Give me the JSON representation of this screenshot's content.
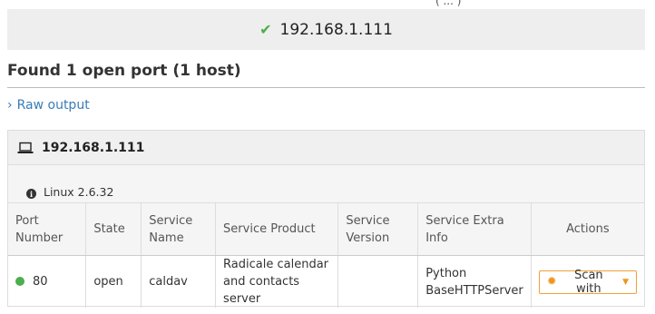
{
  "top_clip": "( ... )",
  "banner": {
    "icon": "check-icon",
    "host": "192.168.1.111",
    "accent": "#4cae4c"
  },
  "summary": {
    "title": "Found 1 open port (1 host)"
  },
  "raw_output": {
    "label": "Raw output",
    "icon": "chevron-right-icon",
    "color": "#3a7cb7"
  },
  "host_panel": {
    "icon": "laptop-icon",
    "host": "192.168.1.111",
    "os": "Linux 2.6.32",
    "os_icon": "info-icon"
  },
  "table": {
    "headers": {
      "port_number": [
        "Port",
        "Number"
      ],
      "state": "State",
      "service_name": [
        "Service",
        "Name"
      ],
      "service_product": "Service Product",
      "service_version": [
        "Service",
        "Version"
      ],
      "service_extra": [
        "Service Extra",
        "Info"
      ],
      "actions": "Actions"
    },
    "rows": [
      {
        "status_color": "#4cae4c",
        "port": "80",
        "state": "open",
        "service": "caldav",
        "product": [
          "Radicale calendar",
          "and contacts server"
        ],
        "version": "",
        "extra": [
          "Python",
          "BaseHTTPServer"
        ],
        "action_label": "Scan with"
      }
    ]
  }
}
